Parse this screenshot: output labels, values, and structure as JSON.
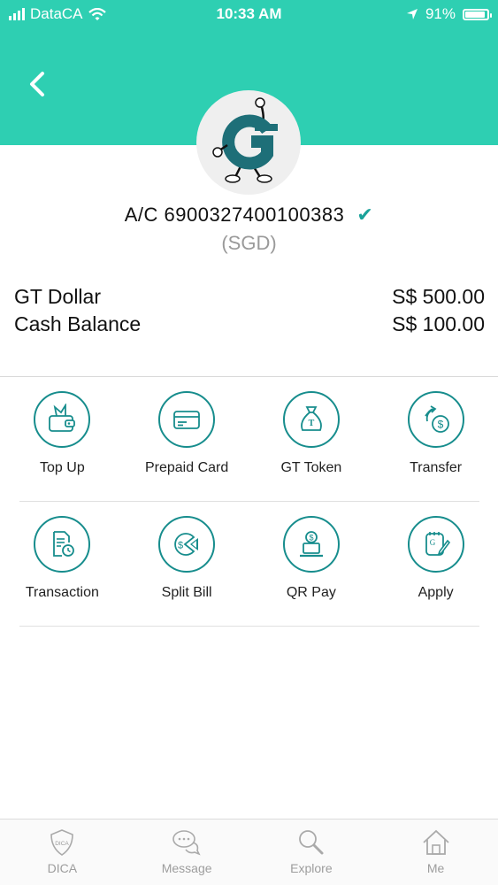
{
  "status_bar": {
    "carrier": "DataCA",
    "time": "10:33 AM",
    "battery_percent": "91%",
    "battery_level": 0.91
  },
  "account": {
    "number": "A/C 6900327400100383",
    "currency": "(SGD)",
    "verified_icon": "check-icon"
  },
  "balances": [
    {
      "label": "GT Dollar",
      "value": "S$ 500.00"
    },
    {
      "label": "Cash Balance",
      "value": "S$ 100.00"
    }
  ],
  "actions_row1": [
    {
      "label": "Top Up",
      "icon": "wallet-icon"
    },
    {
      "label": "Prepaid Card",
      "icon": "card-icon"
    },
    {
      "label": "GT Token",
      "icon": "money-bag-icon"
    },
    {
      "label": "Transfer",
      "icon": "transfer-icon"
    }
  ],
  "actions_row2": [
    {
      "label": "Transaction",
      "icon": "document-clock-icon"
    },
    {
      "label": "Split Bill",
      "icon": "pie-dollar-icon"
    },
    {
      "label": "QR Pay",
      "icon": "qr-laptop-icon"
    },
    {
      "label": "Apply",
      "icon": "form-pen-icon"
    }
  ],
  "tab_bar": [
    {
      "label": "DICA",
      "icon": "shield-icon",
      "icon_text": "DICA"
    },
    {
      "label": "Message",
      "icon": "chat-icon"
    },
    {
      "label": "Explore",
      "icon": "magnifier-icon"
    },
    {
      "label": "Me",
      "icon": "home-icon"
    }
  ],
  "colors": {
    "header": "#2ecfb2",
    "accent": "#178d8d",
    "muted": "#9d9d9d"
  }
}
